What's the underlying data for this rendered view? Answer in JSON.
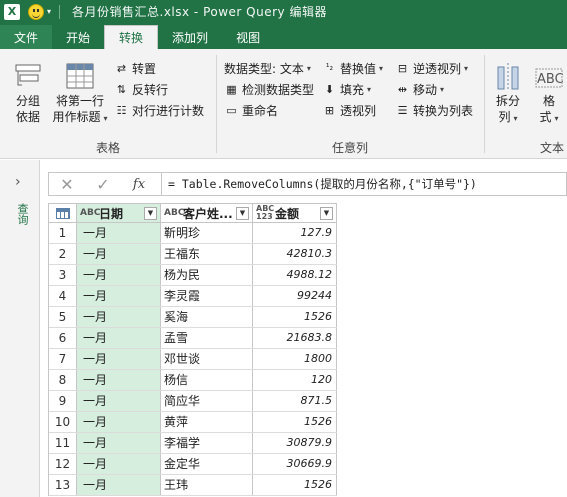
{
  "titlebar": {
    "app_icon": "X",
    "title": "各月份销售汇总.xlsx - Power Query 编辑器"
  },
  "tabs": [
    {
      "label": "文件"
    },
    {
      "label": "开始"
    },
    {
      "label": "转换"
    },
    {
      "label": "添加列"
    },
    {
      "label": "视图"
    }
  ],
  "ribbon": {
    "table_group": {
      "label": "表格",
      "group_by": "分组\n依据",
      "use_first_row": "将第一行\n用作标题",
      "transpose": "转置",
      "reverse_rows": "反转行",
      "count_rows": "对行进行计数"
    },
    "any_column_group": {
      "label": "任意列",
      "data_type": "数据类型: 文本",
      "detect_type": "检测数据类型",
      "rename": "重命名",
      "replace_values": "替换值",
      "fill": "填充",
      "pivot_column": "透视列",
      "unpivot_columns": "逆透视列",
      "move": "移动",
      "convert_to_list": "转换为列表"
    },
    "text_group": {
      "label": "文本",
      "split_column": "拆分\n列",
      "format": "格\n式"
    }
  },
  "side_panel": {
    "label": "查询"
  },
  "formula_bar": {
    "fx": "fx",
    "formula": "= Table.RemoveColumns(提取的月份名称,{\"订单号\"})"
  },
  "table": {
    "columns": [
      {
        "type": "ABC",
        "name": "日期"
      },
      {
        "type": "ABC",
        "name": "客户姓..."
      },
      {
        "type": "ABC\n123",
        "name": "金额"
      }
    ],
    "rows": [
      {
        "n": "1",
        "date": "一月",
        "name": "靳明珍",
        "amount": "127.9"
      },
      {
        "n": "2",
        "date": "一月",
        "name": "王福东",
        "amount": "42810.3"
      },
      {
        "n": "3",
        "date": "一月",
        "name": "杨为民",
        "amount": "4988.12"
      },
      {
        "n": "4",
        "date": "一月",
        "name": "李灵霞",
        "amount": "99244"
      },
      {
        "n": "5",
        "date": "一月",
        "name": "奚海",
        "amount": "1526"
      },
      {
        "n": "6",
        "date": "一月",
        "name": "孟雪",
        "amount": "21683.8"
      },
      {
        "n": "7",
        "date": "一月",
        "name": "邓世谈",
        "amount": "1800"
      },
      {
        "n": "8",
        "date": "一月",
        "name": "杨信",
        "amount": "120"
      },
      {
        "n": "9",
        "date": "一月",
        "name": "简应华",
        "amount": "871.5"
      },
      {
        "n": "10",
        "date": "一月",
        "name": "黄萍",
        "amount": "1526"
      },
      {
        "n": "11",
        "date": "一月",
        "name": "李福学",
        "amount": "30879.9"
      },
      {
        "n": "12",
        "date": "一月",
        "name": "金定华",
        "amount": "30669.9"
      },
      {
        "n": "13",
        "date": "一月",
        "name": "王玮",
        "amount": "1526"
      }
    ]
  },
  "colors": {
    "accent": "#217346",
    "selected_column": "#d6eedd"
  }
}
